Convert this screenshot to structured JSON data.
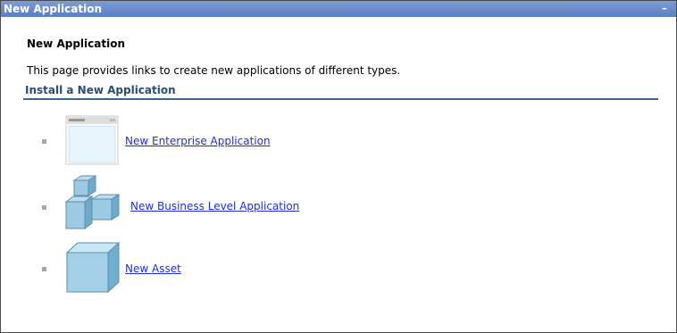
{
  "panel": {
    "title": "New Application",
    "collapse_glyph": "–"
  },
  "content": {
    "heading": "New Application",
    "description": "This page provides links to create new applications of different types.",
    "section_title": "Install a New Application",
    "items": [
      {
        "label": "New Enterprise Application",
        "icon": "enterprise-app-window-icon"
      },
      {
        "label": "New Business Level Application",
        "icon": "business-app-cubes-icon"
      },
      {
        "label": "New Asset",
        "icon": "asset-cube-icon"
      }
    ]
  },
  "colors": {
    "titlebar": "#5a7fc2",
    "link": "#1f2fd8",
    "section_rule": "#3d6496"
  }
}
